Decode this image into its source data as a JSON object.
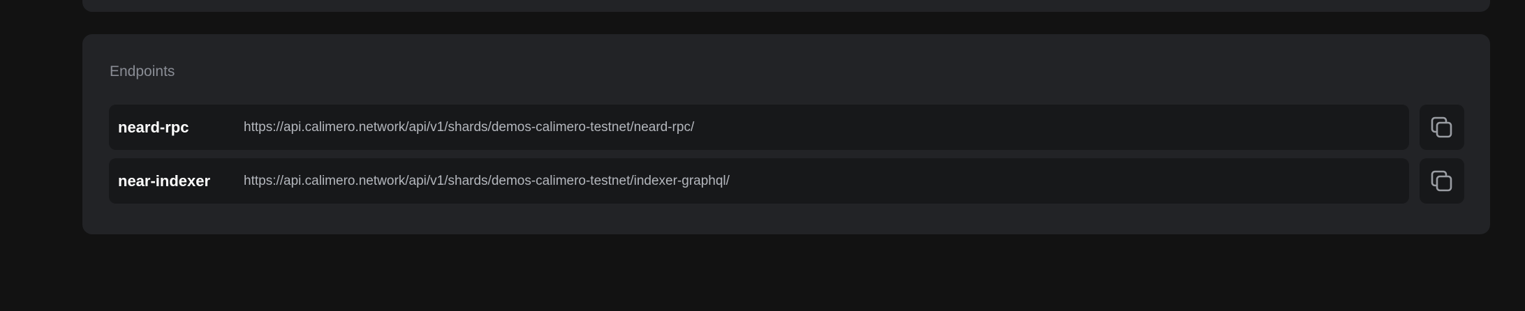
{
  "endpoints_card": {
    "title": "Endpoints",
    "items": [
      {
        "name": "neard-rpc",
        "url": "https://api.calimero.network/api/v1/shards/demos-calimero-testnet/neard-rpc/",
        "copy_icon": "copy-icon"
      },
      {
        "name": "near-indexer",
        "url": "https://api.calimero.network/api/v1/shards/demos-calimero-testnet/indexer-graphql/",
        "copy_icon": "copy-icon"
      }
    ]
  }
}
